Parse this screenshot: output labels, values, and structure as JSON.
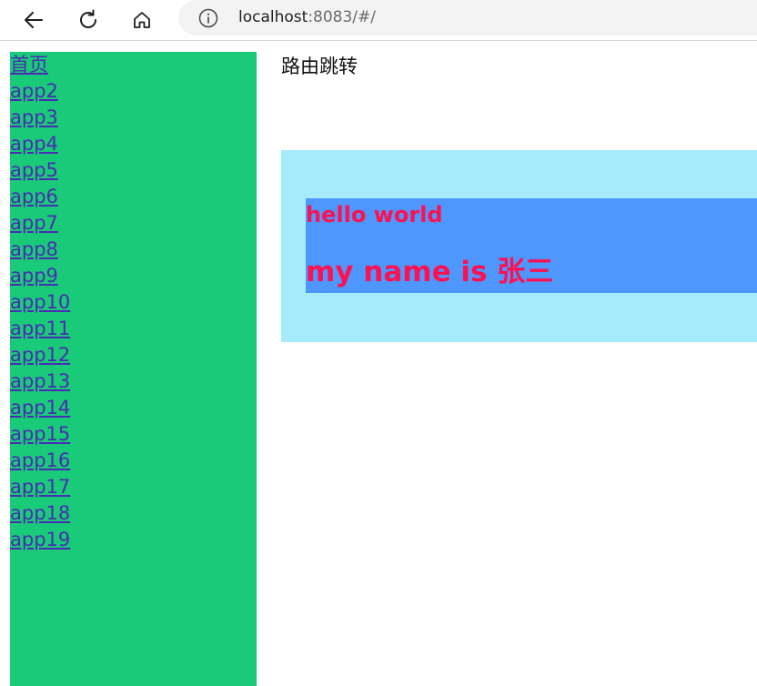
{
  "browser": {
    "url_host": "localhost",
    "url_rest": ":8083/#/",
    "icons": {
      "back": "arrow-left-icon",
      "reload": "reload-icon",
      "home": "home-icon",
      "info": "info-icon"
    }
  },
  "sidebar": {
    "background": "#19cb78",
    "link_color": "#4a2bb5",
    "links": [
      "首页",
      "app2",
      "app3",
      "app4",
      "app5",
      "app6",
      "app7",
      "app8",
      "app9",
      "app10",
      "app11",
      "app12",
      "app13",
      "app14",
      "app15",
      "app16",
      "app17",
      "app18",
      "app19"
    ]
  },
  "main": {
    "title": "路由跳转",
    "hello_text": "hello world",
    "name_text": "my name is 张三",
    "colors": {
      "outer_box": "#a6ebfb",
      "inner_box": "#4d97ff",
      "text": "#ff1050"
    }
  }
}
